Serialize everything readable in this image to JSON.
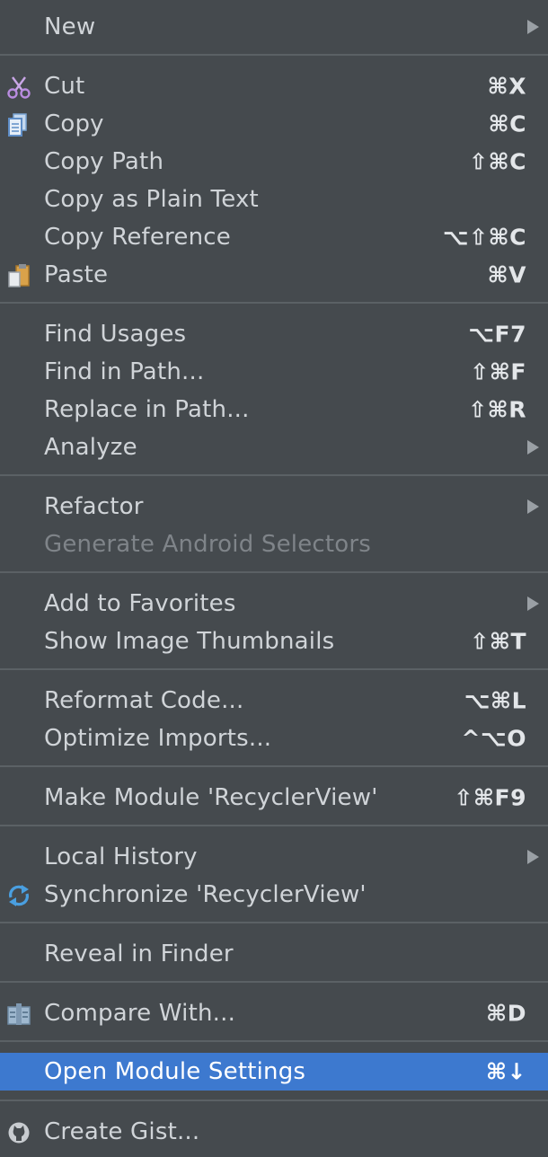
{
  "menu": {
    "items": [
      {
        "label": "New",
        "shortcut": "",
        "submenu": true,
        "icon": "",
        "state": "normal"
      },
      {
        "label": "Cut",
        "shortcut": "⌘X",
        "submenu": false,
        "icon": "scissors-icon",
        "state": "normal"
      },
      {
        "label": "Copy",
        "shortcut": "⌘C",
        "submenu": false,
        "icon": "copy-icon",
        "state": "normal"
      },
      {
        "label": "Copy Path",
        "shortcut": "⇧⌘C",
        "submenu": false,
        "icon": "",
        "state": "normal"
      },
      {
        "label": "Copy as Plain Text",
        "shortcut": "",
        "submenu": false,
        "icon": "",
        "state": "normal"
      },
      {
        "label": "Copy Reference",
        "shortcut": "⌥⇧⌘C",
        "submenu": false,
        "icon": "",
        "state": "normal"
      },
      {
        "label": "Paste",
        "shortcut": "⌘V",
        "submenu": false,
        "icon": "paste-icon",
        "state": "normal"
      },
      {
        "label": "Find Usages",
        "shortcut": "⌥F7",
        "submenu": false,
        "icon": "",
        "state": "normal"
      },
      {
        "label": "Find in Path...",
        "shortcut": "⇧⌘F",
        "submenu": false,
        "icon": "",
        "state": "normal"
      },
      {
        "label": "Replace in Path...",
        "shortcut": "⇧⌘R",
        "submenu": false,
        "icon": "",
        "state": "normal"
      },
      {
        "label": "Analyze",
        "shortcut": "",
        "submenu": true,
        "icon": "",
        "state": "normal"
      },
      {
        "label": "Refactor",
        "shortcut": "",
        "submenu": true,
        "icon": "",
        "state": "normal"
      },
      {
        "label": "Generate Android Selectors",
        "shortcut": "",
        "submenu": false,
        "icon": "",
        "state": "disabled"
      },
      {
        "label": "Add to Favorites",
        "shortcut": "",
        "submenu": true,
        "icon": "",
        "state": "normal"
      },
      {
        "label": "Show Image Thumbnails",
        "shortcut": "⇧⌘T",
        "submenu": false,
        "icon": "",
        "state": "normal"
      },
      {
        "label": "Reformat Code...",
        "shortcut": "⌥⌘L",
        "submenu": false,
        "icon": "",
        "state": "normal"
      },
      {
        "label": "Optimize Imports...",
        "shortcut": "^⌥O",
        "submenu": false,
        "icon": "",
        "state": "normal"
      },
      {
        "label": "Make Module 'RecyclerView'",
        "shortcut": "⇧⌘F9",
        "submenu": false,
        "icon": "",
        "state": "normal"
      },
      {
        "label": "Local History",
        "shortcut": "",
        "submenu": true,
        "icon": "",
        "state": "normal"
      },
      {
        "label": "Synchronize 'RecyclerView'",
        "shortcut": "",
        "submenu": false,
        "icon": "synchronize-icon",
        "state": "normal"
      },
      {
        "label": "Reveal in Finder",
        "shortcut": "",
        "submenu": false,
        "icon": "",
        "state": "normal"
      },
      {
        "label": "Compare With...",
        "shortcut": "⌘D",
        "submenu": false,
        "icon": "compare-icon",
        "state": "normal"
      },
      {
        "label": "Open Module Settings",
        "shortcut": "⌘↓",
        "submenu": false,
        "icon": "",
        "state": "selected"
      },
      {
        "label": "Create Gist...",
        "shortcut": "",
        "submenu": false,
        "icon": "github-icon",
        "state": "normal"
      }
    ]
  },
  "colors": {
    "menu_background": "#454a4e",
    "selection": "#3d79cf",
    "separator": "#5b6165",
    "text": "#d0d4d8",
    "disabled_text": "#7f8489"
  }
}
